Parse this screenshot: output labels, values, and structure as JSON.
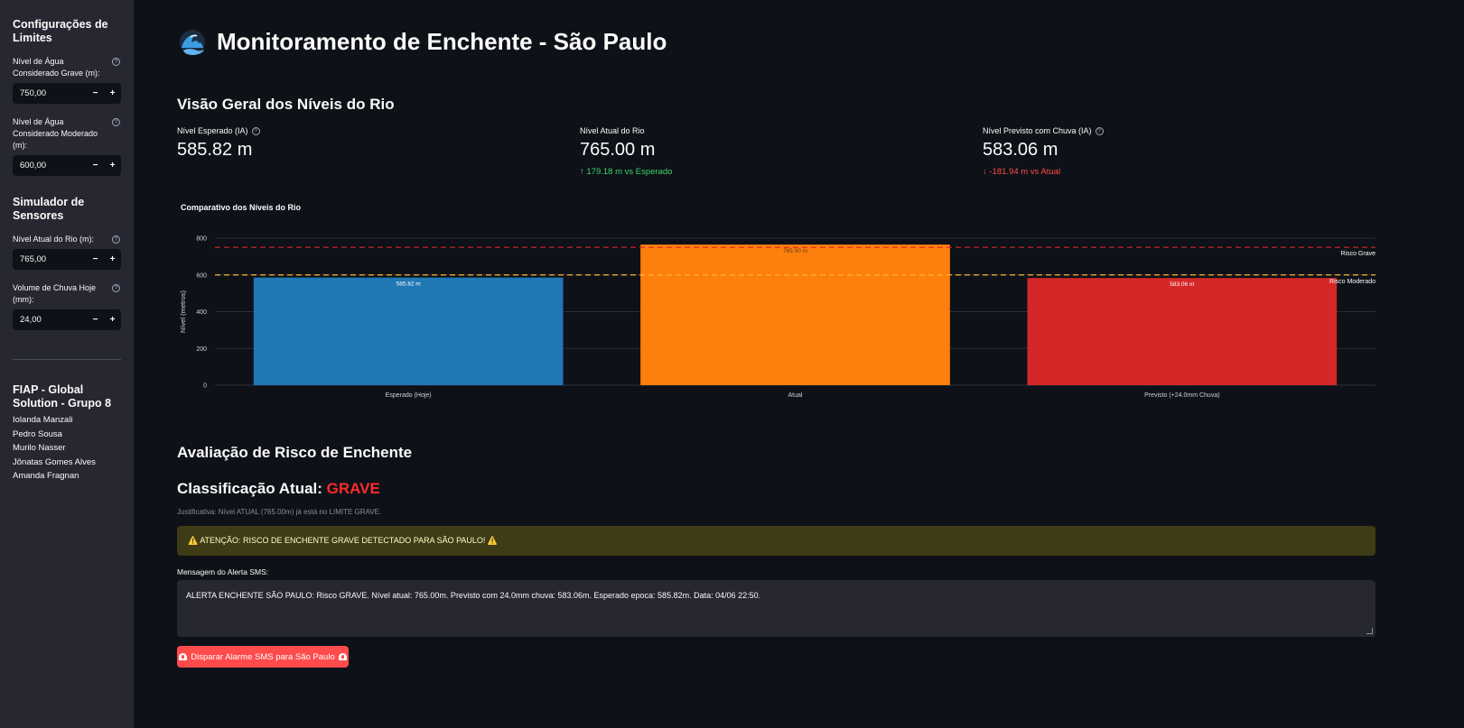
{
  "sidebar": {
    "limits_title": "Configurações de Limites",
    "grave_label": "Nível de Água Considerado Grave (m):",
    "grave_value": "750,00",
    "moderate_label": "Nível de Água Considerado Moderado (m):",
    "moderate_value": "600,00",
    "sensors_title": "Simulador de Sensores",
    "river_label": "Nível Atual do Rio (m):",
    "river_value": "765,00",
    "rain_label": "Volume de Chuva Hoje (mm):",
    "rain_value": "24,00",
    "minus": "−",
    "plus": "+",
    "help": "?",
    "team_title": "FIAP - Global Solution - Grupo 8",
    "members": [
      "Iolanda Manzali",
      "Pedro Sousa",
      "Murilo Nasser",
      "Jônatas Gomes Alves",
      "Amanda Fragnan"
    ]
  },
  "main": {
    "title": "Monitoramento de Enchente - São Paulo",
    "overview_title": "Visão Geral dos Níveis do Rio",
    "metrics": [
      {
        "label": "Nível Esperado (IA)",
        "value": "585.82 m",
        "delta": ""
      },
      {
        "label": "Nível Atual do Rio",
        "value": "765.00 m",
        "delta": "↑  179.18 m vs Esperado"
      },
      {
        "label": "Nível Previsto com Chuva (IA)",
        "value": "583.06 m",
        "delta": "↓  -181.94 m vs Atual"
      }
    ],
    "risk_title": "Avaliação de Risco de Enchente",
    "classification_prefix": "Classificação Atual: ",
    "classification_value": "GRAVE",
    "justification": "Justificativa: Nível ATUAL (765.00m) já está no LIMITE GRAVE.",
    "warning": "⚠️  ATENÇÃO: RISCO DE ENCHENTE GRAVE DETECTADO PARA SÃO PAULO!  ⚠️",
    "sms_label": "Mensagem do Alerta SMS:",
    "sms_text": "ALERTA ENCHENTE SÃO PAULO: Risco GRAVE. Nível atual: 765.00m. Previsto com 24.0mm chuva: 583.06m. Esperado epoca: 585.82m. Data: 04/06 22:50.",
    "sms_button": "Disparar Alarme SMS para São Paulo"
  },
  "colors": {
    "expected": "#1f77b4",
    "current": "#ff7f0e",
    "forecast": "#d62728",
    "grave_line": "#d62728",
    "moderate_line": "#ffb62b"
  },
  "chart_data": {
    "type": "bar",
    "title": "Comparativo dos Níveis do Rio",
    "ylabel": "Nível (metros)",
    "xlabel": "",
    "categories": [
      "Esperado (Hoje)",
      "Atual",
      "Previsto (+24.0mm Chuva)"
    ],
    "values": [
      585.82,
      765.0,
      583.06
    ],
    "data_labels": [
      "585.82 m",
      "765.00 m",
      "583.06 m"
    ],
    "ylim": [
      0,
      800
    ],
    "yticks": [
      0,
      200,
      400,
      600,
      800
    ],
    "grid": true,
    "reference_lines": [
      {
        "name": "Risco Grave",
        "value": 750
      },
      {
        "name": "Risco Moderado",
        "value": 600
      }
    ]
  }
}
